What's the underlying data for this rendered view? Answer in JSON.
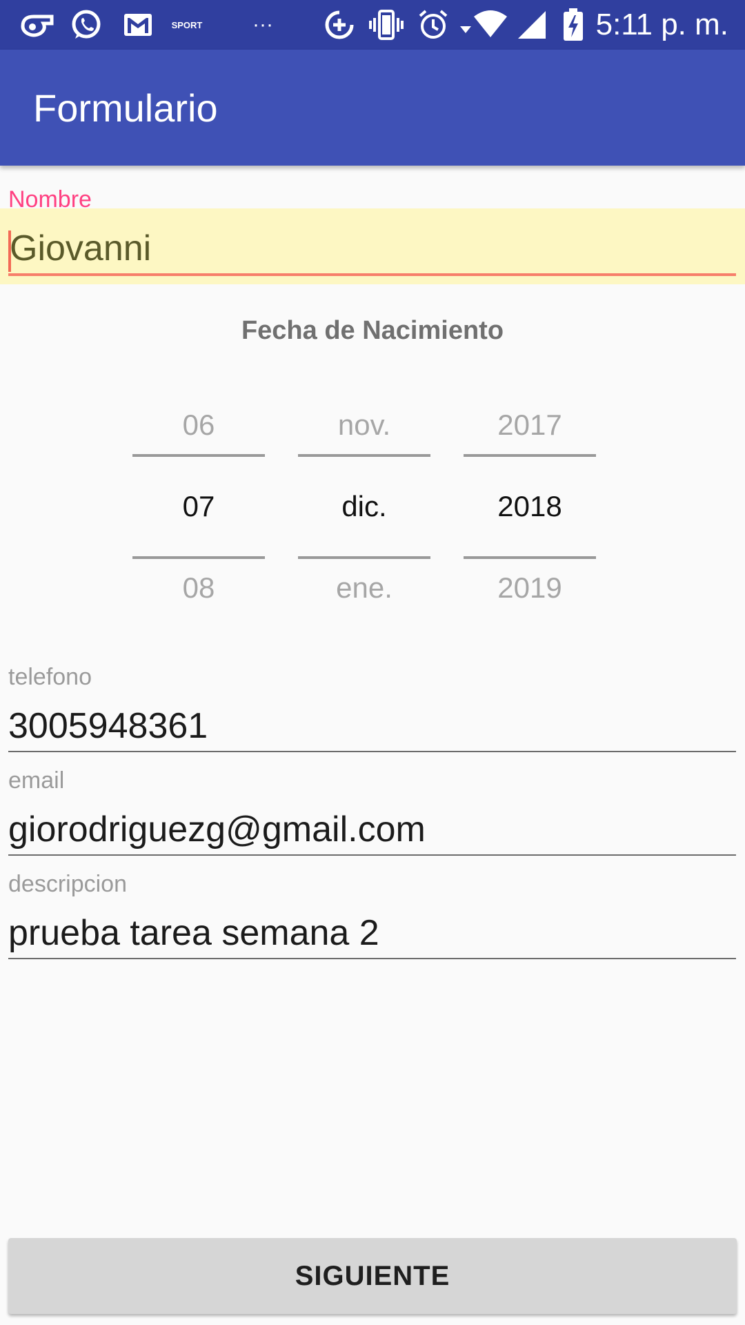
{
  "status_bar": {
    "time": "5:11 p. m.",
    "notification_icons": [
      "whistle-icon",
      "whatsapp-icon",
      "gmail-icon",
      "sport-app-icon",
      "more-dots-icon"
    ],
    "system_icons": [
      "data-saver-icon",
      "vibrate-icon",
      "alarm-icon",
      "wifi-icon",
      "signal-icon",
      "battery-charging-icon"
    ],
    "sport_badge": "SPORT",
    "more_dots": "···"
  },
  "app_bar": {
    "title": "Formulario",
    "color": "#3f51b5",
    "status_color": "#303f9f"
  },
  "form": {
    "nombre": {
      "label": "Nombre",
      "value": "Giovanni",
      "accent_color": "#ff4081",
      "highlight_color": "#fdf7c3"
    },
    "fecha": {
      "title": "Fecha de Nacimiento",
      "day": {
        "prev": "06",
        "selected": "07",
        "next": "08"
      },
      "month": {
        "prev": "nov.",
        "selected": "dic.",
        "next": "ene."
      },
      "year": {
        "prev": "2017",
        "selected": "2018",
        "next": "2019"
      }
    },
    "telefono": {
      "label": "telefono",
      "value": "3005948361"
    },
    "email": {
      "label": "email",
      "value": "giorodriguezg@gmail.com"
    },
    "descripcion": {
      "label": "descripcion",
      "value": "prueba tarea semana 2"
    }
  },
  "button": {
    "label": "SIGUIENTE"
  }
}
